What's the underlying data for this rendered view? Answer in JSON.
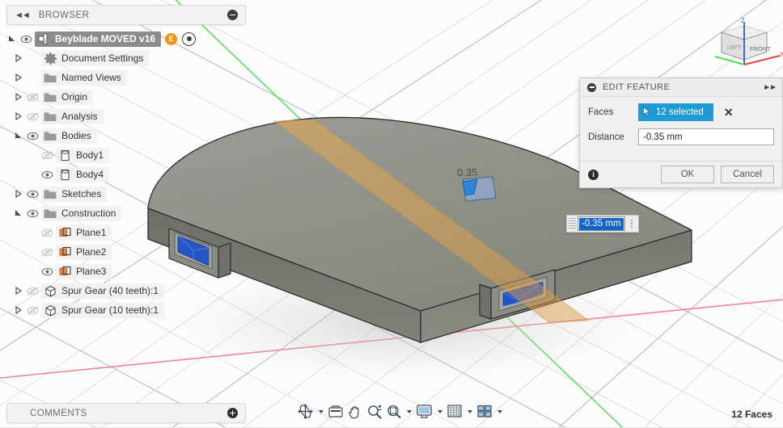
{
  "app": {
    "product": "Fusion 360",
    "accent_blue": "#1e9bd7",
    "select_blue": "#1264c8",
    "plane_orange": "#e08a4a",
    "highlight_gray": "#8c8c8c",
    "axis_x_color": "#f2787c",
    "axis_y_color": "#4fdc4f",
    "axis_z_color": "#3a6fd8",
    "body_color": "#8e9089",
    "tab_blue": "#2457c5"
  },
  "browser": {
    "title": "BROWSER",
    "collapse_icon": "collapse-left-icon",
    "minimize_icon": "minus-icon",
    "root": {
      "label": "Beyblade MOVED v16",
      "expander": "expanded",
      "visibility": "visible",
      "icon": "component-icon",
      "badge": "E",
      "target_icon": "activate-component-icon",
      "selected": true
    },
    "items": [
      {
        "label": "Document Settings",
        "indent": 1,
        "expander": "collapsed",
        "visibility": "none",
        "icon": "gear-icon"
      },
      {
        "label": "Named Views",
        "indent": 1,
        "expander": "collapsed",
        "visibility": "none",
        "icon": "folder-icon"
      },
      {
        "label": "Origin",
        "indent": 1,
        "expander": "collapsed",
        "visibility": "hidden",
        "icon": "folder-icon"
      },
      {
        "label": "Analysis",
        "indent": 1,
        "expander": "collapsed",
        "visibility": "hidden",
        "icon": "folder-icon"
      },
      {
        "label": "Bodies",
        "indent": 1,
        "expander": "expanded",
        "visibility": "visible",
        "icon": "folder-icon"
      },
      {
        "label": "Body1",
        "indent": 2,
        "expander": "none",
        "visibility": "hidden",
        "icon": "body-icon"
      },
      {
        "label": "Body4",
        "indent": 2,
        "expander": "none",
        "visibility": "visible",
        "icon": "body-icon"
      },
      {
        "label": "Sketches",
        "indent": 1,
        "expander": "collapsed",
        "visibility": "visible",
        "icon": "folder-icon"
      },
      {
        "label": "Construction",
        "indent": 1,
        "expander": "expanded",
        "visibility": "visible",
        "icon": "folder-icon"
      },
      {
        "label": "Plane1",
        "indent": 2,
        "expander": "none",
        "visibility": "hidden",
        "icon": "plane-icon"
      },
      {
        "label": "Plane2",
        "indent": 2,
        "expander": "none",
        "visibility": "hidden",
        "icon": "plane-icon"
      },
      {
        "label": "Plane3",
        "indent": 2,
        "expander": "none",
        "visibility": "visible",
        "icon": "plane-icon"
      },
      {
        "label": "Spur Gear (40 teeth):1",
        "indent": 1,
        "expander": "collapsed",
        "visibility": "hidden",
        "icon": "component-cube-icon"
      },
      {
        "label": "Spur Gear (10 teeth):1",
        "indent": 1,
        "expander": "collapsed",
        "visibility": "hidden",
        "icon": "component-cube-icon"
      }
    ]
  },
  "dialog": {
    "title": "EDIT FEATURE",
    "minimize_icon": "minus-icon",
    "expand_icon": "expand-right-icon",
    "faces_label": "Faces",
    "faces_value": "12 selected",
    "faces_clear_icon": "x-icon",
    "distance_label": "Distance",
    "distance_value": "-0.35 mm",
    "info_icon": "info-icon",
    "ok_label": "OK",
    "cancel_label": "Cancel"
  },
  "canvas": {
    "manipulator_value": "-0.35 mm",
    "face_drag_label": "0.35",
    "grip_icon": "drag-grip-icon",
    "options_icon": "more-options-icon",
    "cursor_icon": "arrow-cursor-icon"
  },
  "viewcube": {
    "front_label": "FRONT",
    "left_label": "LEFT",
    "axis_z": "Z",
    "axis_x": "X"
  },
  "comments": {
    "title": "COMMENTS",
    "add_icon": "plus-icon"
  },
  "navbar": {
    "items": [
      {
        "name": "orbit-icon",
        "caret": true
      },
      {
        "name": "look-at-icon",
        "caret": false
      },
      {
        "name": "pan-hand-icon",
        "caret": false
      },
      {
        "name": "zoom-icon",
        "caret": false
      },
      {
        "name": "zoom-window-icon",
        "caret": true
      },
      {
        "name": "display-settings-icon",
        "caret": true
      },
      {
        "name": "grid-snaps-icon",
        "caret": true
      },
      {
        "name": "viewports-icon",
        "caret": true
      }
    ]
  },
  "statusbar": {
    "faces_count": "12 Faces"
  }
}
